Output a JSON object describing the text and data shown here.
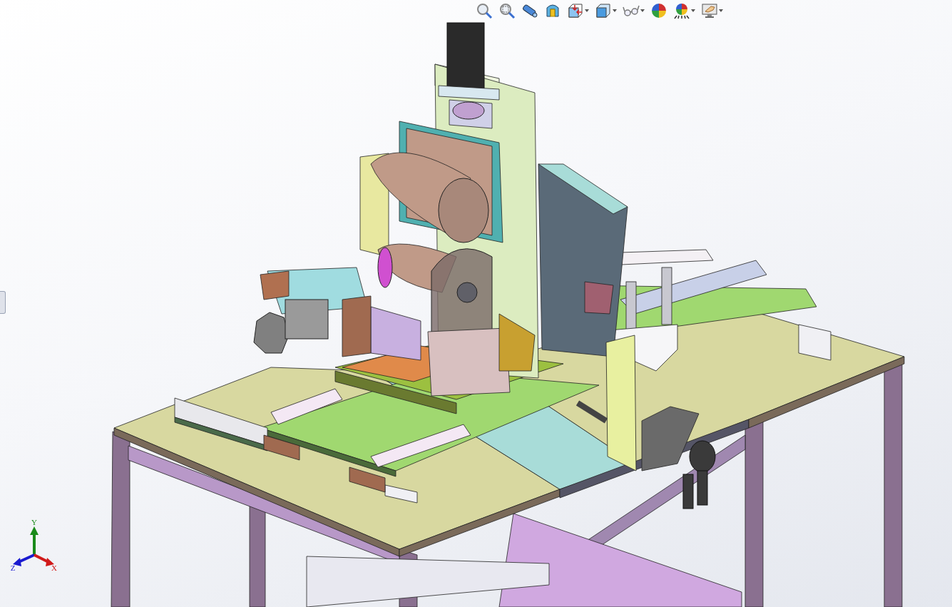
{
  "toolbar": {
    "buttons": [
      {
        "kind": "zoom-fit",
        "dropdown": false
      },
      {
        "kind": "zoom-area",
        "dropdown": false
      },
      {
        "kind": "previous-view",
        "dropdown": false
      },
      {
        "kind": "section-view",
        "dropdown": false
      },
      {
        "kind": "view-orientation",
        "dropdown": true
      },
      {
        "kind": "display-style",
        "dropdown": true
      },
      {
        "kind": "hide-show",
        "dropdown": true
      },
      {
        "kind": "appearance",
        "dropdown": false
      },
      {
        "kind": "scene",
        "dropdown": true
      },
      {
        "kind": "view-settings",
        "dropdown": true
      }
    ]
  },
  "triad": {
    "axes": [
      {
        "label": "Y",
        "color": "#1a8a1a"
      },
      {
        "label": "Z",
        "color": "#1a1ad0"
      },
      {
        "label": "X",
        "color": "#d01a1a"
      }
    ]
  }
}
